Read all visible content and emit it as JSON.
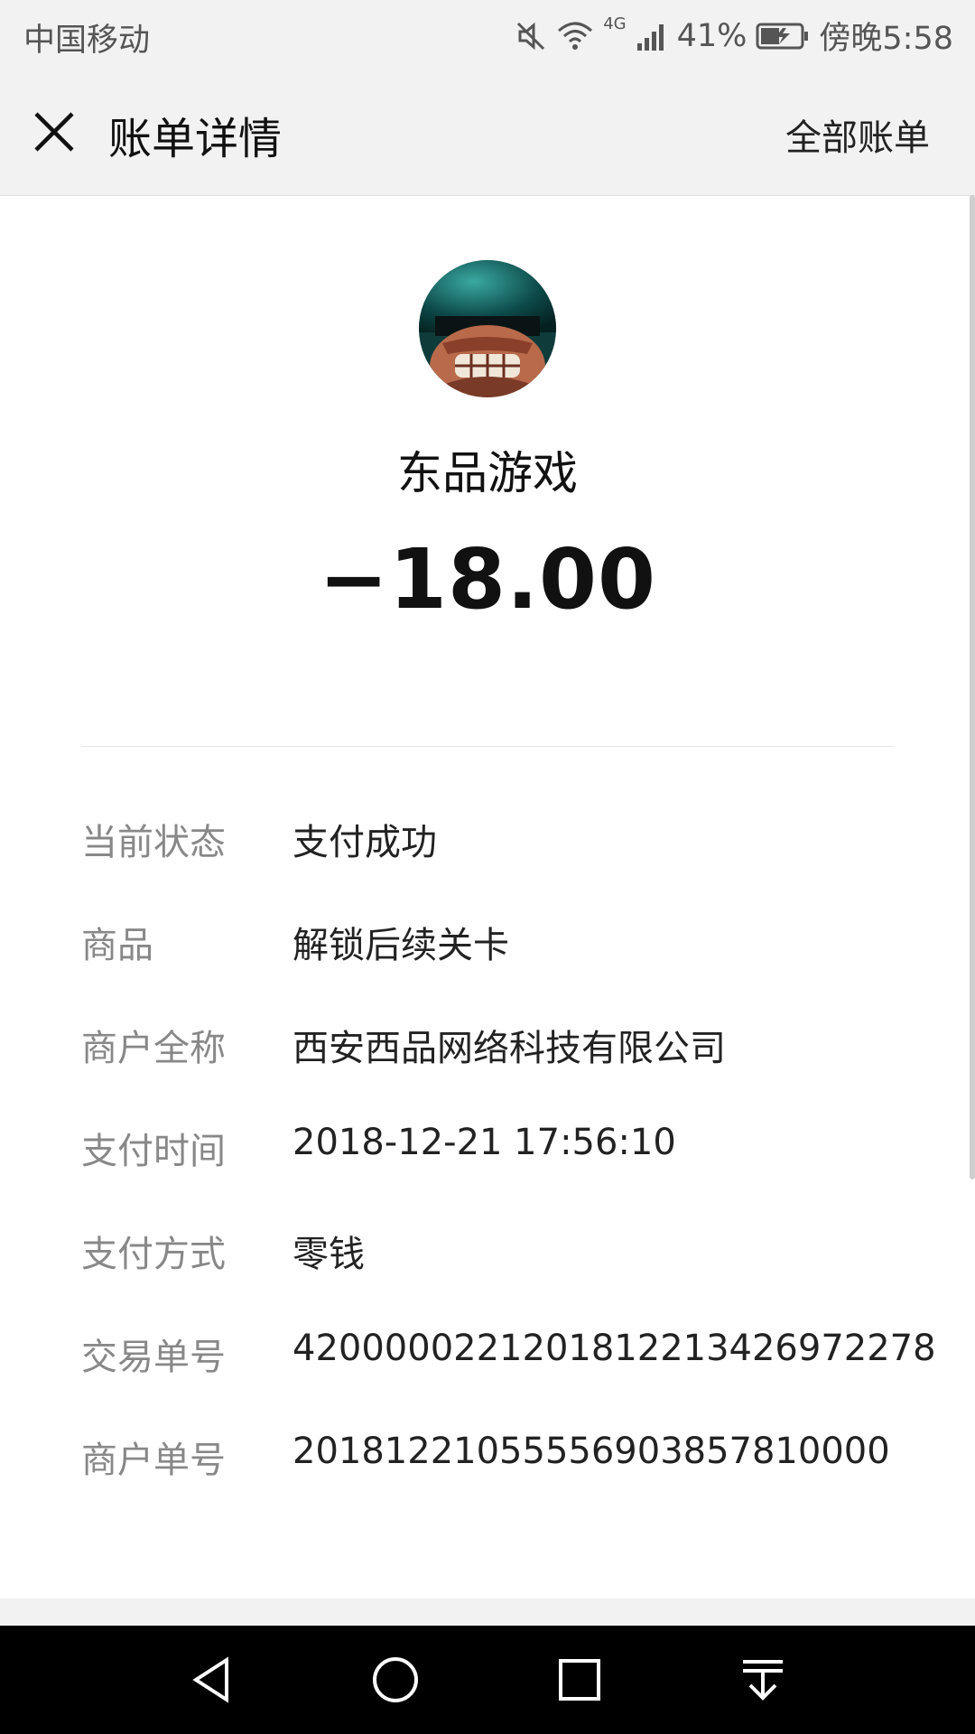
{
  "status_bar": {
    "carrier": "中国移动",
    "network": "4G",
    "battery": "41%",
    "time": "傍晚5:58",
    "icons": [
      "mute-icon",
      "wifi-icon",
      "signal-icon",
      "battery-icon"
    ]
  },
  "header": {
    "title": "账单详情",
    "all_bills": "全部账单",
    "close_icon": "close-icon"
  },
  "bill": {
    "merchant_name": "东品游戏",
    "amount": "−18.00",
    "avatar_icon": "game-avatar-icon",
    "rows": [
      {
        "label": "当前状态",
        "value": "支付成功"
      },
      {
        "label": "商品",
        "value": "解锁后续关卡"
      },
      {
        "label": "商户全称",
        "value": "西安西品网络科技有限公司"
      },
      {
        "label": "支付时间",
        "value": "2018-12-21 17:56:10"
      },
      {
        "label": "支付方式",
        "value": "零钱"
      },
      {
        "label": "交易单号",
        "value": "4200000221201812213426972278"
      },
      {
        "label": "商户单号",
        "value": "2018122105555690385781000​0"
      }
    ]
  },
  "nav_bar": {
    "icons": [
      "back-icon",
      "home-icon",
      "recents-icon",
      "notification-pull-icon"
    ]
  },
  "colors": {
    "background": "#ffffff",
    "header_bg": "#f2f2f2",
    "label": "#888888",
    "text": "#111111"
  }
}
